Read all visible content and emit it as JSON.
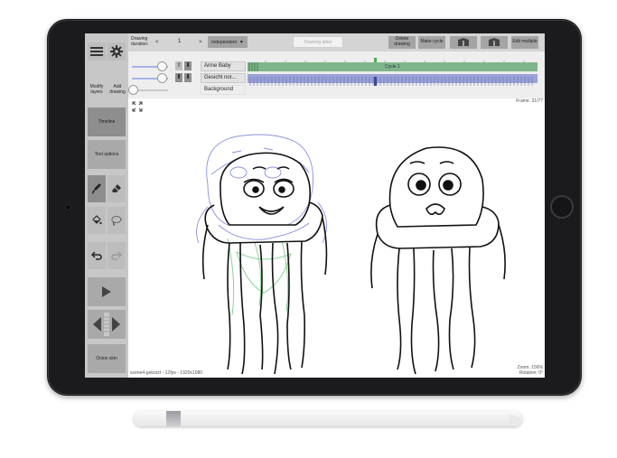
{
  "sidebar": {
    "modify_layers": "Modify layers",
    "add_drawing": "Add drawing",
    "timeline": "Timeline",
    "tool_options": "Tool options",
    "onion_skin": "Onion skin"
  },
  "topbar": {
    "drawing_duration_label": "Drawing duration:",
    "prev": "<",
    "duration_value": "1",
    "next": ">",
    "mode": "Independent",
    "drawing_label_placeholder": "Drawing label",
    "delete_drawing": "Delete drawing",
    "make_cycle": "Make cycle",
    "edit_multiple": "Edit multiple"
  },
  "timeline": {
    "layers": [
      "Arme Baby",
      "Gesicht nor...",
      "Background"
    ],
    "track_label": "Cycle 1"
  },
  "canvas": {
    "frame_info": "Frame: 31/77",
    "scene_info": "szene4-gekürzt - 12fps - 1920x1080",
    "zoom_info": "Zoom: 156%",
    "rotation_info": "Rotation: 0°"
  },
  "colors": {
    "accent_green": "#7fb58b",
    "accent_blue": "#9aa2d8"
  }
}
